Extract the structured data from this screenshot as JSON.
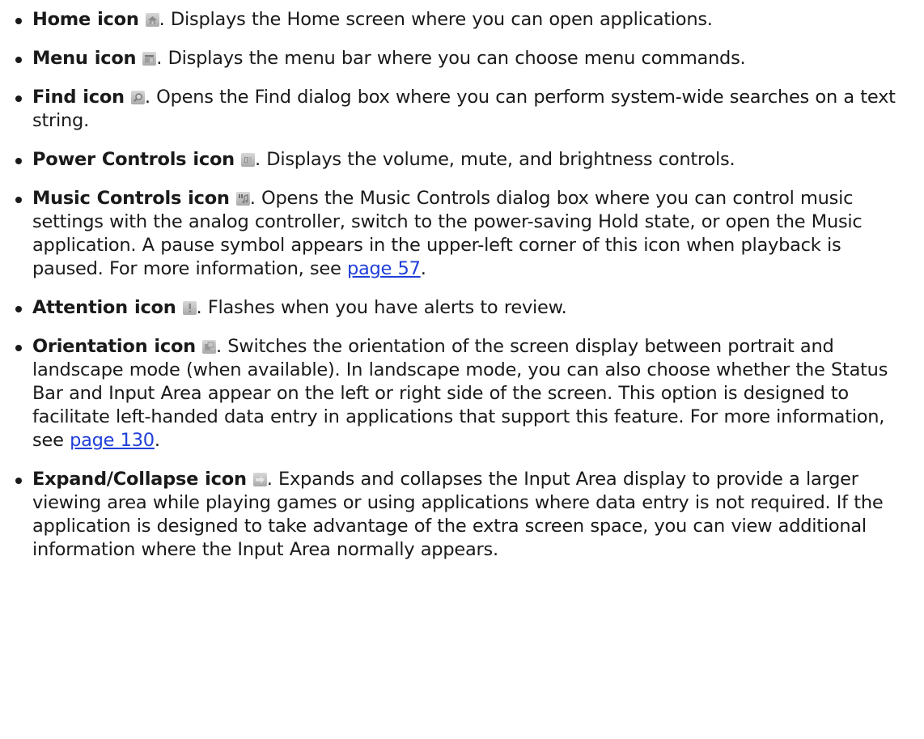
{
  "items": [
    {
      "term": "Home icon",
      "icon": "home-icon",
      "text": ". Displays the Home screen where you can open applications."
    },
    {
      "term": "Menu icon",
      "icon": "menu-icon",
      "text": ". Displays the menu bar where you can choose menu commands."
    },
    {
      "term": "Find icon",
      "icon": "find-icon",
      "text": ". Opens the Find dialog box where you can perform system-wide searches on a text string."
    },
    {
      "term": "Power Controls icon",
      "icon": "power-controls-icon",
      "text": ". Displays the volume, mute, and brightness controls."
    },
    {
      "term": "Music Controls icon",
      "icon": "music-controls-icon",
      "text": ". Opens the Music Controls dialog box where you can control music settings with the analog controller, switch to the power-saving Hold state, or open the Music application. A pause symbol appears in the upper-left corner of this icon when playback is paused. For more information, see ",
      "link": "page 57",
      "after": "."
    },
    {
      "term": "Attention icon",
      "icon": "attention-icon",
      "text": ". Flashes when you have alerts to review."
    },
    {
      "term": "Orientation icon",
      "icon": "orientation-icon",
      "text": ". Switches the orientation of the screen display between portrait and landscape mode (when available). In landscape mode, you can also choose whether the Status Bar and Input Area appear on the left or right side of the screen. This option is designed to facilitate left-handed data entry in applications that support this feature. For more information, see ",
      "link": "page 130",
      "after": "."
    },
    {
      "term": "Expand/Collapse icon",
      "icon": "expand-collapse-icon",
      "text": ". Expands and collapses the Input Area display to provide a larger viewing area while playing games or using applications where data entry is not required. If the application is designed to take advantage of the extra screen space, you can view additional information where the Input Area normally appears."
    }
  ]
}
